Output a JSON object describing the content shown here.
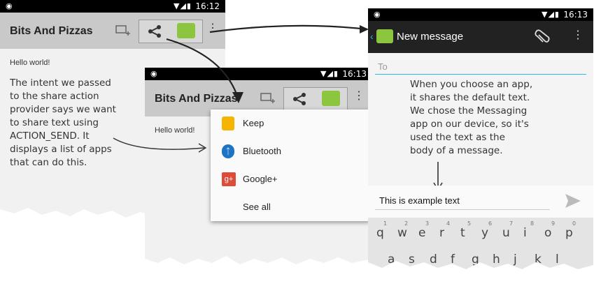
{
  "screen1": {
    "time": "16:12",
    "title": "Bits And Pizzas",
    "hello": "Hello world!",
    "annotation": [
      "The intent we passed",
      "to the share action",
      "provider says we want",
      "to share text using",
      "ACTION_SEND. It",
      "displays a list of apps",
      "that can do this."
    ]
  },
  "screen2": {
    "time": "16:13",
    "title": "Bits And Pizzas",
    "hello": "Hello world!",
    "menu": [
      {
        "label": "Keep",
        "icon": "keep-icon",
        "color": "#f5b400"
      },
      {
        "label": "Bluetooth",
        "icon": "bluetooth-icon",
        "color": "#1e74c4"
      },
      {
        "label": "Google+",
        "icon": "google-plus-icon",
        "color": "#dd4b39"
      },
      {
        "label": "See all",
        "icon": "",
        "color": ""
      }
    ]
  },
  "screen3": {
    "time": "16:13",
    "title": "New message",
    "to_placeholder": "To",
    "annotation": [
      "When you choose an app,",
      "it shares the default text.",
      "We chose the Messaging",
      "app on our device, so it's",
      "used the text as the",
      "body of a message."
    ],
    "message_text": "This is example text",
    "keyboard_row1": [
      "q",
      "w",
      "e",
      "r",
      "t",
      "y",
      "u",
      "i",
      "o",
      "p"
    ],
    "keyboard_nums": [
      "1",
      "2",
      "3",
      "4",
      "5",
      "6",
      "7",
      "8",
      "9",
      "0"
    ],
    "keyboard_row2": [
      "a",
      "s",
      "d",
      "f",
      "g",
      "h",
      "j",
      "k",
      "l"
    ]
  },
  "colors": {
    "actionbar": "#c9c9c9",
    "accent_green": "#8cc63f",
    "holo_blue": "#33b5e5",
    "darkbar": "#222222"
  }
}
